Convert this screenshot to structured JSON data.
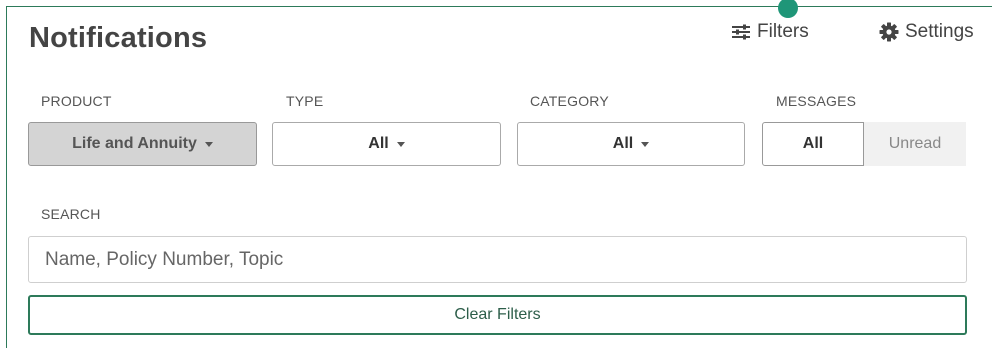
{
  "header": {
    "title": "Notifications",
    "filters_label": "Filters",
    "settings_label": "Settings",
    "has_new_indicator": true
  },
  "filters": {
    "product": {
      "label": "PRODUCT",
      "value": "Life and Annuity"
    },
    "type": {
      "label": "TYPE",
      "value": "All"
    },
    "category": {
      "label": "CATEGORY",
      "value": "All"
    },
    "messages": {
      "label": "MESSAGES",
      "options": [
        "All",
        "Unread"
      ],
      "selected": "All"
    }
  },
  "search": {
    "label": "SEARCH",
    "value": "",
    "placeholder": "Name, Policy Number, Topic"
  },
  "actions": {
    "clear_label": "Clear Filters"
  },
  "colors": {
    "accent": "#2d7a5a",
    "indicator": "#1f9678",
    "disabled_select_bg": "#d4d4d4"
  },
  "icons": {
    "filters": "sliders-icon",
    "settings": "gear-icon",
    "dropdown": "caret-down-icon"
  }
}
